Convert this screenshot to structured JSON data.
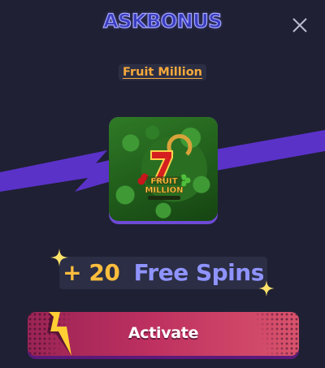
{
  "header": {
    "title": "ASKBONUS",
    "close_icon": "close-icon"
  },
  "game": {
    "name": "Fruit Million",
    "thumbnail_icon": "fruit-million-logo"
  },
  "bonus": {
    "amount": "+ 20",
    "label": "Free Spins"
  },
  "actions": {
    "activate_label": "Activate"
  },
  "colors": {
    "background": "#1f2033",
    "title_fill": "#3a3cbf",
    "title_outline": "#a6a8ff",
    "game_link": "#f6a93b",
    "bonus_amount": "#ffbe3d",
    "bonus_label": "#8f93ff",
    "button_gradient_start": "#9b2455",
    "button_gradient_end": "#d9536c",
    "bolt_stripe": "#5a32c8"
  }
}
